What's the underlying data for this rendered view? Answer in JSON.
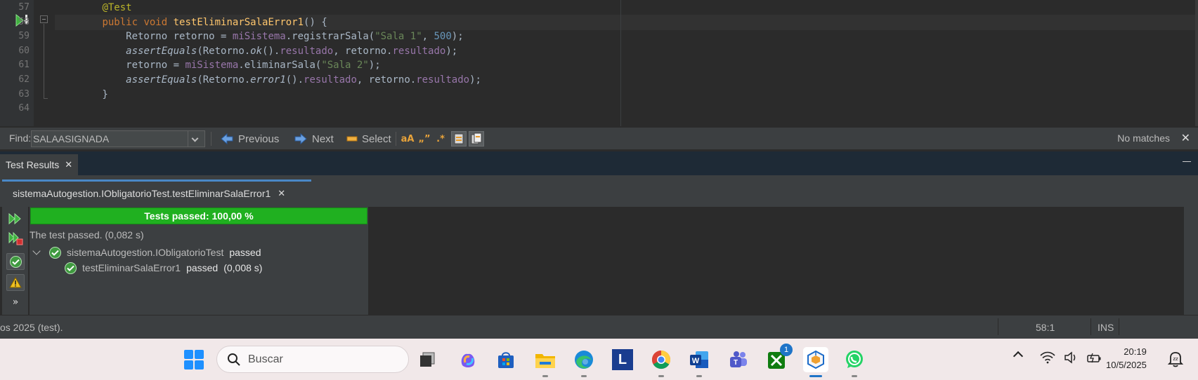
{
  "editor": {
    "line_numbers": [
      "57",
      "58",
      "59",
      "60",
      "61",
      "62",
      "63",
      "64"
    ],
    "lines": [
      {
        "parts": [
          {
            "t": "        ",
            "c": "plain"
          },
          {
            "t": "@Test",
            "c": "ann"
          }
        ]
      },
      {
        "parts": [
          {
            "t": "        ",
            "c": "plain"
          },
          {
            "t": "public",
            "c": "kw"
          },
          {
            "t": " ",
            "c": "plain"
          },
          {
            "t": "void",
            "c": "kw"
          },
          {
            "t": " ",
            "c": "plain"
          },
          {
            "t": "testEliminarSalaError1",
            "c": "mth"
          },
          {
            "t": "() {",
            "c": "plain"
          }
        ]
      },
      {
        "parts": [
          {
            "t": "            Retorno retorno = ",
            "c": "plain"
          },
          {
            "t": "miSistema",
            "c": "fld"
          },
          {
            "t": ".",
            "c": "plain"
          },
          {
            "t": "registrarSala",
            "c": "plain"
          },
          {
            "t": "(",
            "c": "plain"
          },
          {
            "t": "\"Sala 1\"",
            "c": "str"
          },
          {
            "t": ", ",
            "c": "plain"
          },
          {
            "t": "500",
            "c": "num"
          },
          {
            "t": ");",
            "c": "plain"
          }
        ]
      },
      {
        "parts": [
          {
            "t": "            ",
            "c": "plain"
          },
          {
            "t": "assertEquals",
            "c": "plain it"
          },
          {
            "t": "(Retorno.",
            "c": "plain"
          },
          {
            "t": "ok",
            "c": "plain it"
          },
          {
            "t": "().",
            "c": "plain"
          },
          {
            "t": "resultado",
            "c": "fld"
          },
          {
            "t": ", retorno.",
            "c": "plain"
          },
          {
            "t": "resultado",
            "c": "fld"
          },
          {
            "t": ");",
            "c": "plain"
          }
        ]
      },
      {
        "parts": [
          {
            "t": "            retorno = ",
            "c": "plain"
          },
          {
            "t": "miSistema",
            "c": "fld"
          },
          {
            "t": ".",
            "c": "plain"
          },
          {
            "t": "eliminarSala",
            "c": "plain"
          },
          {
            "t": "(",
            "c": "plain"
          },
          {
            "t": "\"Sala 2\"",
            "c": "str"
          },
          {
            "t": ");",
            "c": "plain"
          }
        ]
      },
      {
        "parts": [
          {
            "t": "            ",
            "c": "plain"
          },
          {
            "t": "assertEquals",
            "c": "plain it"
          },
          {
            "t": "(Retorno.",
            "c": "plain"
          },
          {
            "t": "error1",
            "c": "plain it"
          },
          {
            "t": "().",
            "c": "plain"
          },
          {
            "t": "resultado",
            "c": "fld"
          },
          {
            "t": ", retorno.",
            "c": "plain"
          },
          {
            "t": "resultado",
            "c": "fld"
          },
          {
            "t": ");",
            "c": "plain"
          }
        ]
      },
      {
        "parts": [
          {
            "t": "        }",
            "c": "plain"
          }
        ]
      },
      {
        "parts": [
          {
            "t": "",
            "c": "plain"
          }
        ]
      }
    ],
    "current_line_index": 1
  },
  "findbar": {
    "label": "Find:",
    "value": "SALAASIGNADA",
    "previous_label": "Previous",
    "next_label": "Next",
    "select_label": "Select",
    "match_case_glyph": "aA",
    "whole_word_glyph": "„”",
    "regex_glyph": ".*",
    "status": "No matches",
    "close_glyph": "✕"
  },
  "test_results": {
    "window_tab": "Test Results",
    "close_glyph": "✕",
    "session_tab": "sistemaAutogestion.IObligatorioTest.testEliminarSalaError1",
    "progress_label": "Tests passed: 100,00 %",
    "progress_fraction": 1.0,
    "summary": "The test passed. (0,082 s)",
    "suite": {
      "name": "sistemaAutogestion.IObligatorioTest",
      "status": "passed"
    },
    "tests": [
      {
        "name": "testEliminarSalaError1",
        "status": "passed",
        "time": "(0,008 s)"
      }
    ],
    "more_glyph": "»"
  },
  "statusbar": {
    "left_text": "os 2025 (test).",
    "position": "58:1",
    "mode": "INS"
  },
  "taskbar": {
    "search_placeholder": "Buscar",
    "teams_badge": "1",
    "time": "20:19",
    "date": "10/5/2025",
    "app_l_letter": "L"
  }
}
